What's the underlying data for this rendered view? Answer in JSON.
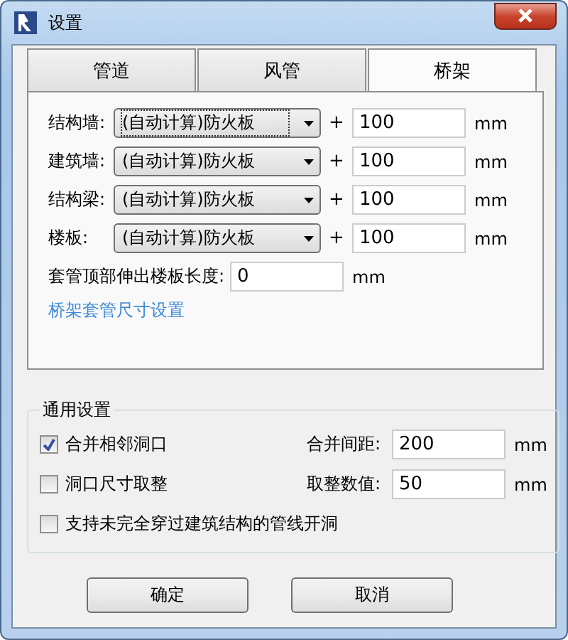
{
  "window": {
    "title": "设置"
  },
  "tabs": [
    {
      "label": "管道",
      "selected": false
    },
    {
      "label": "风管",
      "selected": false
    },
    {
      "label": "桥架",
      "selected": true
    }
  ],
  "offsets": [
    {
      "label": "结构墙:",
      "value": "(自动计算)防火板",
      "focused": true,
      "amount": "100",
      "unit": "mm"
    },
    {
      "label": "建筑墙:",
      "value": "(自动计算)防火板",
      "focused": false,
      "amount": "100",
      "unit": "mm"
    },
    {
      "label": "结构梁:",
      "value": "(自动计算)防火板",
      "focused": false,
      "amount": "100",
      "unit": "mm"
    },
    {
      "label": "楼板:",
      "value": "(自动计算)防火板",
      "focused": false,
      "amount": "100",
      "unit": "mm"
    }
  ],
  "plus": "+",
  "extension": {
    "label": "套管顶部伸出楼板长度:",
    "value": "0",
    "unit": "mm"
  },
  "link": "桥架套管尺寸设置",
  "general": {
    "title": "通用设置",
    "options": [
      {
        "label": "合并相邻洞口",
        "checked": true,
        "field_label": "合并间距:",
        "value": "200",
        "unit": "mm"
      },
      {
        "label": "洞口尺寸取整",
        "checked": false,
        "field_label": "取整数值:",
        "value": "50",
        "unit": "mm"
      },
      {
        "label": "支持未完全穿过建筑结构的管线开洞",
        "checked": false
      }
    ]
  },
  "buttons": [
    "确定",
    "取消"
  ]
}
